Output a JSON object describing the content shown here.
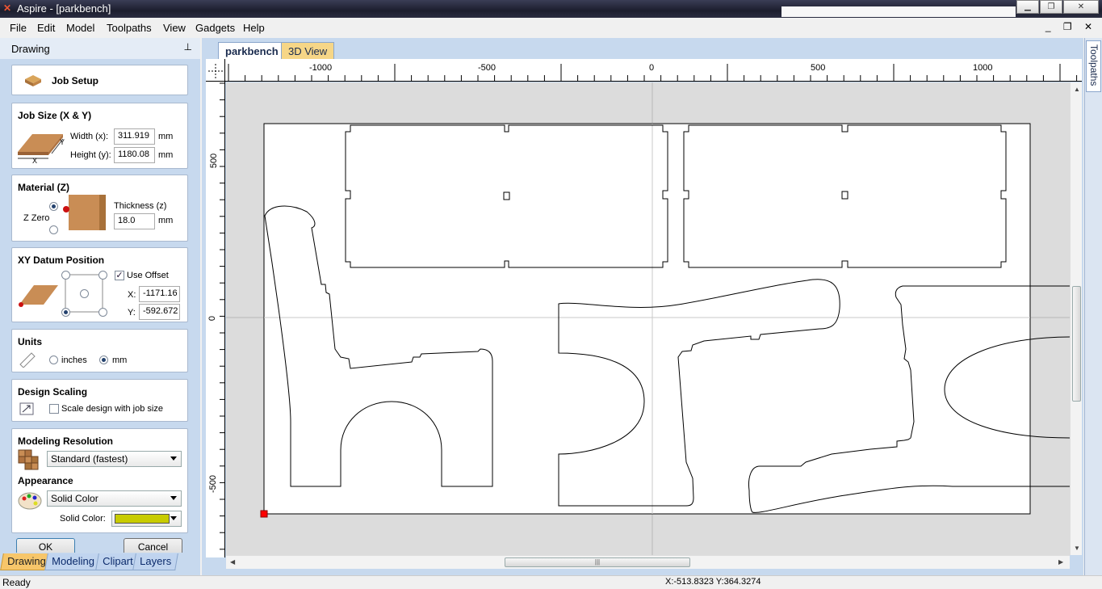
{
  "window": {
    "title": "Aspire - [parkbench]",
    "app_icon": "aspire-logo-icon",
    "buttons": [
      "minimize-icon",
      "maximize-icon",
      "close-icon"
    ]
  },
  "menu": {
    "items": [
      "File",
      "Edit",
      "Model",
      "Toolpaths",
      "View",
      "Gadgets",
      "Help"
    ],
    "mdi_buttons": "_ ❐ ✕"
  },
  "panel": {
    "title": "Drawing",
    "pin_glyph": "📌",
    "job_setup": {
      "label": "Job Setup",
      "icon": "job-setup-icon"
    },
    "job_size": {
      "heading": "Job Size (X & Y)",
      "width_label": "Width (x):",
      "width_value": "311.919",
      "width_unit": "mm",
      "height_label": "Height (y):",
      "height_value": "1180.08",
      "height_unit": "mm",
      "axis_x": "X",
      "axis_y": "Y"
    },
    "material": {
      "heading": "Material (Z)",
      "zzero_label": "Z Zero",
      "thickness_label": "Thickness (z)",
      "thickness_value": "18.0",
      "thickness_unit": "mm",
      "zzero_top_selected": true
    },
    "datum": {
      "heading": "XY Datum Position",
      "use_offset_label": "Use Offset",
      "use_offset_checked": true,
      "x_label": "X:",
      "x_value": "-1171.16",
      "y_label": "Y:",
      "y_value": "-592.672"
    },
    "units": {
      "heading": "Units",
      "inches_label": "inches",
      "mm_label": "mm",
      "selected": "mm"
    },
    "scaling": {
      "heading": "Design Scaling",
      "checkbox_label": "Scale design with job size",
      "checked": false
    },
    "resolution": {
      "heading": "Modeling Resolution",
      "value": "Standard (fastest)"
    },
    "appearance": {
      "heading": "Appearance",
      "value": "Solid Color",
      "solid_color_label": "Solid Color:",
      "solid_color": "#c8cc00"
    },
    "ok_label": "OK",
    "cancel_label": "Cancel"
  },
  "bottom_tabs": [
    "Drawing",
    "Modeling",
    "Clipart",
    "Layers"
  ],
  "bottom_tab_active": "Drawing",
  "doc_tabs": {
    "active": "parkbench",
    "other": "3D View"
  },
  "rulers": {
    "top_labels": [
      "-1000",
      "-500",
      "0",
      "500",
      "1000"
    ],
    "left_labels": [
      "500",
      "0",
      "-500"
    ]
  },
  "right_tab": "Toolpaths",
  "status": {
    "left": "Ready",
    "coords": "X:-513.8323 Y:364.3274"
  },
  "colors": {
    "panel_bg": "#c7d9ee",
    "canvas_bg": "#dcdcdc",
    "datum_marker": "#ff0000",
    "active_tab": "#f7c66a"
  }
}
